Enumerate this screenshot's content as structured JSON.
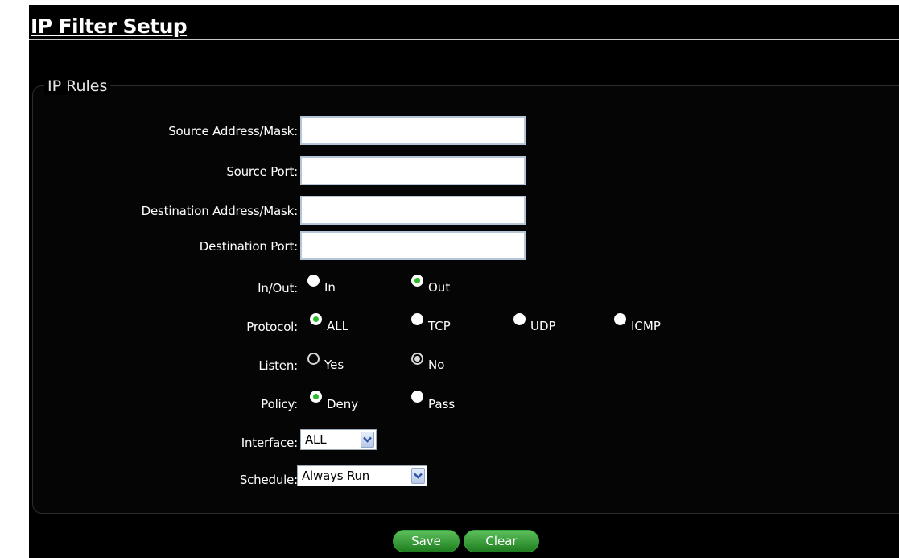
{
  "page": {
    "title": "IP Filter Setup"
  },
  "section": {
    "legend": "IP Rules"
  },
  "fields": {
    "source_address": {
      "label": "Source Address/Mask:",
      "value": ""
    },
    "source_port": {
      "label": "Source Port:",
      "value": ""
    },
    "dest_address": {
      "label": "Destination Address/Mask:",
      "value": ""
    },
    "dest_port": {
      "label": "Destination Port:",
      "value": ""
    }
  },
  "in_out": {
    "label": "In/Out:",
    "options": [
      "In",
      "Out"
    ],
    "selected": "Out"
  },
  "protocol": {
    "label": "Protocol:",
    "options": [
      "ALL",
      "TCP",
      "UDP",
      "ICMP"
    ],
    "selected": "ALL"
  },
  "listen": {
    "label": "Listen:",
    "options": [
      "Yes",
      "No"
    ],
    "selected": "No"
  },
  "policy": {
    "label": "Policy:",
    "options": [
      "Deny",
      "Pass"
    ],
    "selected": "Deny"
  },
  "interface": {
    "label": "Interface:",
    "value": "ALL"
  },
  "schedule": {
    "label": "Schedule:",
    "value": "Always Run"
  },
  "buttons": {
    "save": "Save",
    "clear": "Clear"
  },
  "colors": {
    "background": "#000000",
    "radio_dot": "#2db82d",
    "button_green": "#2e8b2e",
    "input_border": "#b5c6d8"
  },
  "icons": {
    "dropdown": "chevron-down-icon"
  }
}
